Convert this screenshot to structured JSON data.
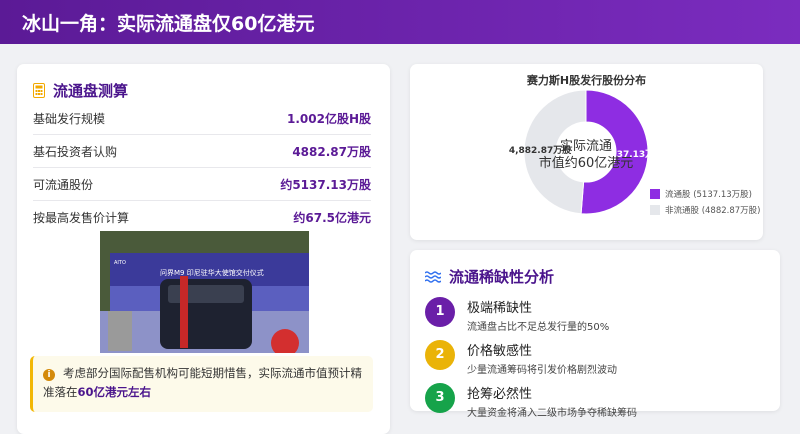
{
  "header": {
    "title": "冰山一角：实际流通盘仅60亿港元"
  },
  "calc": {
    "title": "流通盘测算",
    "rows": [
      {
        "label": "基础发行规模",
        "value": "1.002亿股H股"
      },
      {
        "label": "基石投资者认购",
        "value": "4882.87万股"
      },
      {
        "label": "可流通股份",
        "value": "约5137.13万股"
      },
      {
        "label": "按最高发售价计算",
        "value": "约67.5亿港元"
      }
    ],
    "photo": {
      "brand": "AITO",
      "banner": "问界M9 印尼驻华大使馆交付仪式"
    },
    "note": {
      "text": "考虑部分国际配售机构可能短期惜售，实际流通市值预计精准落在",
      "highlight": "60亿港元左右"
    }
  },
  "chart_data": {
    "type": "pie",
    "title": "赛力斯H股发行股份分布",
    "center_text": [
      "实际流通",
      "市值约60亿港元"
    ],
    "slices": [
      {
        "name": "流通股",
        "value": 5137.13,
        "label": "5,137.13万股",
        "legend": "流通股 (5137.13万股)",
        "color": "#8e2de2"
      },
      {
        "name": "非流通股",
        "value": 4882.87,
        "label": "4,882.87万股",
        "legend": "非流通股 (4882.87万股)",
        "color": "#e5e7eb"
      }
    ],
    "legend_position": "bottom-right"
  },
  "scarcity": {
    "title": "流通稀缺性分析",
    "items": [
      {
        "num": "1",
        "title": "极端稀缺性",
        "desc": "流通盘占比不足总发行量的50%",
        "color": "#6a1fa8"
      },
      {
        "num": "2",
        "title": "价格敏感性",
        "desc": "少量流通筹码将引发价格剧烈波动",
        "color": "#eab308"
      },
      {
        "num": "3",
        "title": "抢筹必然性",
        "desc": "大量资金将涌入二级市场争夺稀缺筹码",
        "color": "#16a34a"
      }
    ]
  }
}
